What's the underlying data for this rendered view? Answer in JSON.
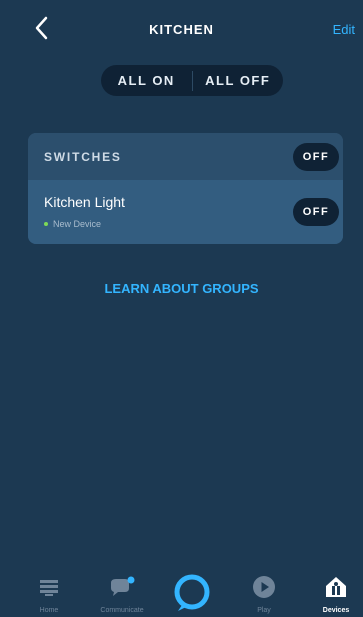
{
  "header": {
    "title": "KITCHEN",
    "edit_label": "Edit"
  },
  "group_controls": {
    "all_on": "ALL ON",
    "all_off": "ALL OFF"
  },
  "switches": {
    "section_label": "SWITCHES",
    "section_state": "OFF",
    "devices": [
      {
        "name": "Kitchen Light",
        "status": "New Device",
        "state": "OFF"
      }
    ]
  },
  "learn_link": "LEARN ABOUT GROUPS",
  "tabbar": {
    "tabs": [
      {
        "label": "Home",
        "icon": "home-icon"
      },
      {
        "label": "Communicate",
        "icon": "chat-icon"
      },
      {
        "label": "",
        "icon": "alexa-icon"
      },
      {
        "label": "Play",
        "icon": "play-icon"
      },
      {
        "label": "Devices",
        "icon": "devices-icon",
        "active": true
      }
    ]
  },
  "colors": {
    "background": "#1c3952",
    "accent": "#33b5ff",
    "pill": "#0f2235",
    "card": "#2c4f6d",
    "row": "#335d80",
    "status_dot": "#7ed957"
  }
}
